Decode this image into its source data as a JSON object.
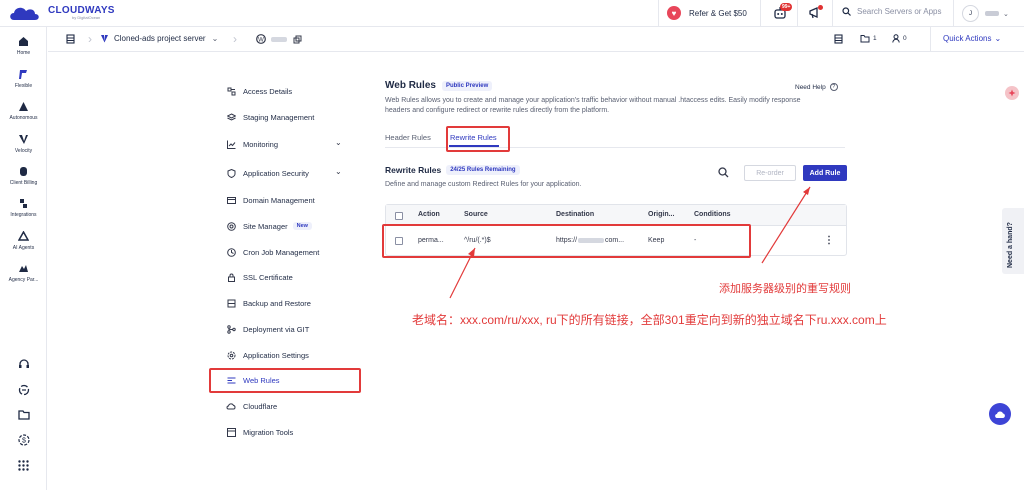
{
  "topbar": {
    "brand": "CLOUDWAYS",
    "brand_sub": "by DigitalOcean",
    "refer": "Refer & Get $50",
    "notification_count": "99+",
    "search_placeholder": "Search Servers or Apps",
    "user_initial": "J"
  },
  "rail": {
    "items": [
      {
        "label": "Home",
        "icon": "home-icon"
      },
      {
        "label": "Flexible",
        "icon": "flexible-icon"
      },
      {
        "label": "Autonomous",
        "icon": "autonomous-icon"
      },
      {
        "label": "Velocity",
        "icon": "velocity-icon"
      },
      {
        "label": "Client Billing",
        "icon": "client-billing-icon"
      },
      {
        "label": "Integrations",
        "icon": "integrations-icon"
      },
      {
        "label": "AI Agents",
        "icon": "ai-agents-icon"
      },
      {
        "label": "Agency Par...",
        "icon": "agency-partner-icon"
      }
    ]
  },
  "subbar": {
    "server_name": "Cloned-ads project server",
    "files_count": "1",
    "users_count": "0",
    "quick_actions": "Quick Actions"
  },
  "menu": {
    "items": [
      "Access Details",
      "Staging Management",
      "Monitoring",
      "Application Security",
      "Domain Management",
      "Site Manager",
      "Cron Job Management",
      "SSL Certificate",
      "Backup and Restore",
      "Deployment via GIT",
      "Application Settings",
      "Web Rules",
      "Cloudflare",
      "Migration Tools"
    ],
    "new_badge": "New"
  },
  "content": {
    "title": "Web Rules",
    "preview_badge": "Public Preview",
    "need_help": "Need Help",
    "description": "Web Rules allows you to create and manage your application's traffic behavior without manual .htaccess edits. Easily modify response headers and configure redirect or rewrite rules directly from the platform.",
    "tabs": [
      "Header Rules",
      "Rewrite Rules"
    ],
    "section_title": "Rewrite Rules",
    "section_badge": "24/25 Rules Remaining",
    "section_desc": "Define and manage custom Redirect Rules for your application.",
    "reorder_label": "Re-order",
    "add_rule_label": "Add Rule",
    "table": {
      "headers": [
        "Action",
        "Source",
        "Destination",
        "Origin...",
        "Conditions"
      ],
      "row": {
        "action": "perma...",
        "source": "^/ru/(.*)$",
        "destination_prefix": "https://",
        "destination_suffix": "com...",
        "origin": "Keep",
        "conditions": "-"
      }
    }
  },
  "annotations": {
    "add_rule_note": "添加服务器级别的重写规则",
    "domain_note": "老域名：xxx.com/ru/xxx, ru下的所有链接，全部301重定向到新的独立域名下ru.xxx.com上"
  },
  "widgets": {
    "need_hand": "Need a hand?"
  },
  "colors": {
    "accent": "#2f39bf",
    "annotation_red": "#e23a3a"
  }
}
